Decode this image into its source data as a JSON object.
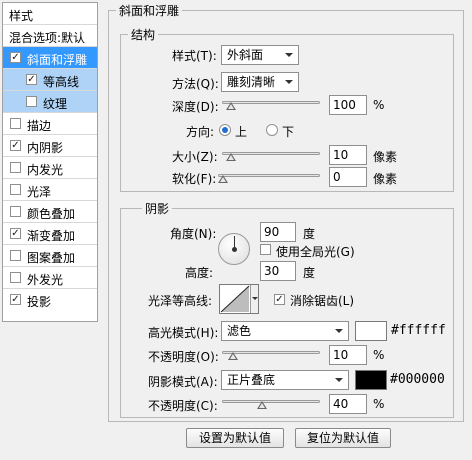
{
  "sidebar": {
    "header": "样式",
    "blending_options": "混合选项:默认",
    "items": [
      {
        "label": "斜面和浮雕",
        "checked": true
      },
      {
        "label": "等高线",
        "checked": true
      },
      {
        "label": "纹理",
        "checked": false
      },
      {
        "label": "描边",
        "checked": false
      },
      {
        "label": "内阴影",
        "checked": true
      },
      {
        "label": "内发光",
        "checked": false
      },
      {
        "label": "光泽",
        "checked": false
      },
      {
        "label": "颜色叠加",
        "checked": false
      },
      {
        "label": "渐变叠加",
        "checked": true
      },
      {
        "label": "图案叠加",
        "checked": false
      },
      {
        "label": "外发光",
        "checked": false
      },
      {
        "label": "投影",
        "checked": true
      }
    ]
  },
  "panel_title": "斜面和浮雕",
  "structure": {
    "legend": "结构",
    "style_label": "样式(T):",
    "style_value": "外斜面",
    "technique_label": "方法(Q):",
    "technique_value": "雕刻清晰",
    "depth_label": "深度(D):",
    "depth_value": "100",
    "depth_unit": "%",
    "direction_label": "方向:",
    "dir_up": "上",
    "dir_down": "下",
    "size_label": "大小(Z):",
    "size_value": "10",
    "size_unit": "像素",
    "soften_label": "软化(F):",
    "soften_value": "0",
    "soften_unit": "像素"
  },
  "shading": {
    "legend": "阴影",
    "angle_label": "角度(N):",
    "angle_value": "90",
    "angle_unit": "度",
    "global_light_label": "使用全局光(G)",
    "global_light_checked": false,
    "altitude_label": "高度:",
    "altitude_value": "30",
    "altitude_unit": "度",
    "gloss_contour_label": "光泽等高线:",
    "antialias_label": "消除锯齿(L)",
    "antialias_checked": true,
    "highlight_mode_label": "高光模式(H):",
    "highlight_mode_value": "滤色",
    "highlight_color": "#ffffff",
    "highlight_color_text": "#ffffff",
    "highlight_opacity_label": "不透明度(O):",
    "highlight_opacity_value": "10",
    "highlight_opacity_unit": "%",
    "shadow_mode_label": "阴影模式(A):",
    "shadow_mode_value": "正片叠底",
    "shadow_color": "#000000",
    "shadow_color_text": "#000000",
    "shadow_opacity_label": "不透明度(C):",
    "shadow_opacity_value": "40",
    "shadow_opacity_unit": "%"
  },
  "buttons": {
    "make_default": "设置为默认值",
    "reset_default": "复位为默认值"
  },
  "checkmark": "✓"
}
